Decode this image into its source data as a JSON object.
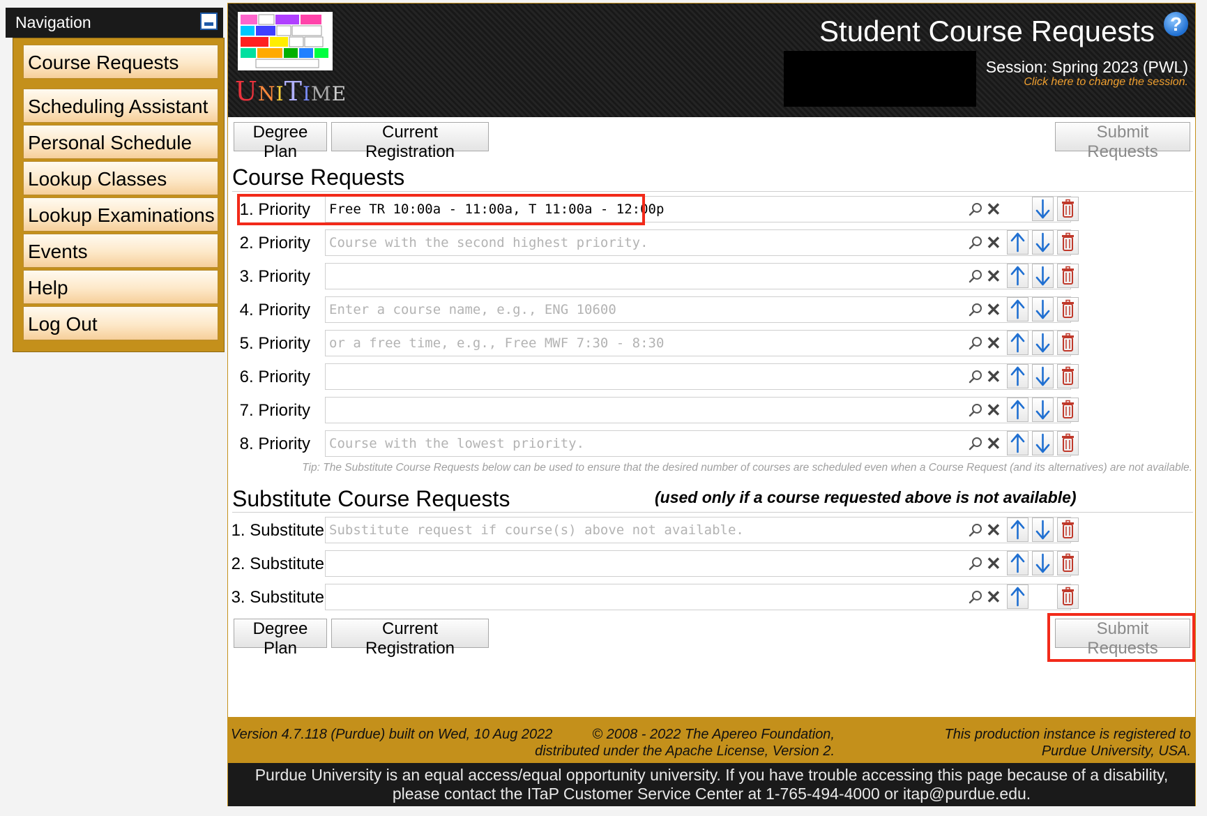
{
  "nav": {
    "header": "Navigation",
    "items": [
      "Course Requests",
      "Scheduling Assistant",
      "Personal Schedule",
      "Lookup Classes",
      "Lookup Examinations",
      "Events",
      "Help",
      "Log Out"
    ]
  },
  "header": {
    "logo_text": "UniTime",
    "title": "Student Course Requests",
    "help_symbol": "?",
    "session": "Session: Spring 2023 (PWL)",
    "session_change": "Click here to change the session."
  },
  "toolbar": {
    "degree_plan": "Degree Plan",
    "current_registration": "Current Registration",
    "submit": "Submit Requests"
  },
  "course_requests": {
    "title": "Course Requests",
    "rows": [
      {
        "label": "1. Priority",
        "value": "Free TR 10:00a - 11:00a, T 11:00a - 12:00p",
        "placeholder": ""
      },
      {
        "label": "2. Priority",
        "value": "",
        "placeholder": "Course with the second highest priority."
      },
      {
        "label": "3. Priority",
        "value": "",
        "placeholder": ""
      },
      {
        "label": "4. Priority",
        "value": "",
        "placeholder": "Enter a course name, e.g., ENG 10600"
      },
      {
        "label": "5. Priority",
        "value": "",
        "placeholder": "or a free time, e.g., Free MWF 7:30 - 8:30"
      },
      {
        "label": "6. Priority",
        "value": "",
        "placeholder": ""
      },
      {
        "label": "7. Priority",
        "value": "",
        "placeholder": ""
      },
      {
        "label": "8. Priority",
        "value": "",
        "placeholder": "Course with the lowest priority."
      }
    ],
    "tip": "Tip: The Substitute Course Requests below can be used to ensure that the desired number of courses are scheduled even when a Course Request (and its alternatives) are not available."
  },
  "substitutes": {
    "title": "Substitute Course Requests",
    "note": "(used only if a course requested above is not available)",
    "rows": [
      {
        "label": "1. Substitute",
        "value": "",
        "placeholder": "Substitute request if course(s) above not available."
      },
      {
        "label": "2. Substitute",
        "value": "",
        "placeholder": ""
      },
      {
        "label": "3. Substitute",
        "value": "",
        "placeholder": ""
      }
    ]
  },
  "footer": {
    "version": "Version 4.7.118 (Purdue) built on Wed, 10 Aug 2022",
    "copyright_1": "© 2008 - 2022 The Apereo Foundation,",
    "copyright_2": "distributed under the Apache License, Version 2.",
    "registered_1": "This production instance is registered to",
    "registered_2": "Purdue University, USA.",
    "notice_1": "Purdue University is an equal access/equal opportunity university. If you have trouble accessing this page because of a disability,",
    "notice_2": "please contact the ITaP Customer Service Center at 1-765-494-4000 or itap@purdue.edu."
  },
  "colors": {
    "nav_gold": "#c4901b",
    "highlight_red": "#f22a1a",
    "arrow_blue": "#1f6fd1",
    "delete_red": "#c0392b"
  },
  "icons": [
    "minimize-icon",
    "help-icon",
    "lookup-icon",
    "clear-icon",
    "arrow-up-icon",
    "arrow-down-icon",
    "trash-icon"
  ]
}
